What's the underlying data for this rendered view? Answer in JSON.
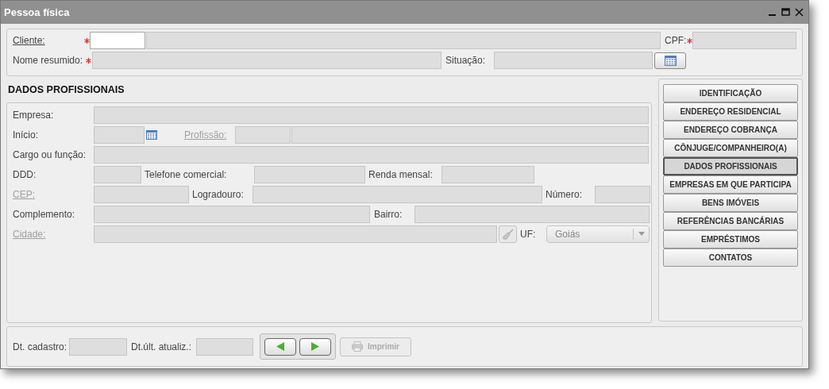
{
  "window": {
    "title": "Pessoa física"
  },
  "header": {
    "cliente": {
      "label": "Cliente:",
      "link": true,
      "required": true,
      "code_enabled": true
    },
    "cpf": {
      "label": "CPF:",
      "required": true
    },
    "nome_resumido": {
      "label": "Nome resumido:",
      "required": true
    },
    "situacao": {
      "label": "Situação:",
      "required": false
    }
  },
  "section_title": "DADOS PROFISSIONAIS",
  "fields": {
    "empresa": {
      "label": "Empresa:"
    },
    "inicio": {
      "label": "Início:"
    },
    "profissao": {
      "label": "Profissão:",
      "link": true,
      "disabled": true
    },
    "cargo": {
      "label": "Cargo ou função:"
    },
    "ddd": {
      "label": "DDD:"
    },
    "telefone": {
      "label": "Telefone comercial:"
    },
    "renda": {
      "label": "Renda mensal:"
    },
    "cep": {
      "label": "CEP:",
      "link": true,
      "disabled": true
    },
    "logradouro": {
      "label": "Logradouro:"
    },
    "numero": {
      "label": "Número:"
    },
    "complemento": {
      "label": "Complemento:"
    },
    "bairro": {
      "label": "Bairro:"
    },
    "cidade": {
      "label": "Cidade:",
      "link": true,
      "disabled": true
    },
    "uf": {
      "label": "UF:",
      "value": "Goiás"
    }
  },
  "nav_buttons": [
    {
      "label": "IDENTIFICAÇÃO",
      "selected": false
    },
    {
      "label": "ENDEREÇO RESIDENCIAL",
      "selected": false
    },
    {
      "label": "ENDEREÇO COBRANÇA",
      "selected": false
    },
    {
      "label": "CÔNJUGE/COMPANHEIRO(A)",
      "selected": false
    },
    {
      "label": "DADOS PROFISSIONAIS",
      "selected": true
    },
    {
      "label": "EMPRESAS EM QUE PARTICIPA",
      "selected": false
    },
    {
      "label": "BENS IMÓVEIS",
      "selected": false
    },
    {
      "label": "REFERÊNCIAS BANCÁRIAS",
      "selected": false
    },
    {
      "label": "EMPRÉSTIMOS",
      "selected": false
    },
    {
      "label": "CONTATOS",
      "selected": false
    }
  ],
  "footer": {
    "cadastro": {
      "label": "Dt. cadastro:"
    },
    "atualiz": {
      "label": "Dt.últ. atualiz.:"
    },
    "print_button": {
      "label": "Imprimir",
      "disabled": true
    }
  }
}
